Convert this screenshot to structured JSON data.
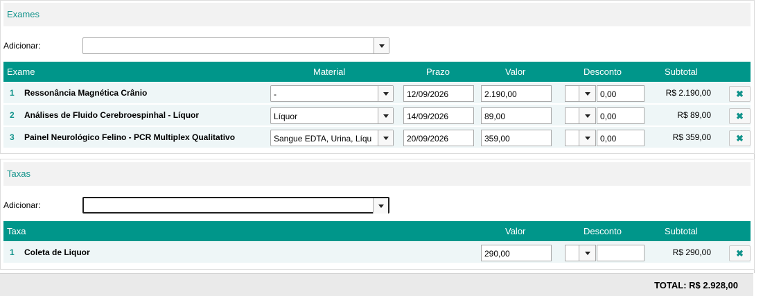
{
  "exames": {
    "title": "Exames",
    "add_label": "Adicionar:",
    "add_value": "",
    "columns": {
      "exame": "Exame",
      "material": "Material",
      "prazo": "Prazo",
      "valor": "Valor",
      "desconto": "Desconto",
      "subtotal": "Subtotal"
    },
    "rows": [
      {
        "num": "1",
        "name": "Ressonância Magnética Crânio",
        "material": "-",
        "prazo": "12/09/2026",
        "valor": "2.190,00",
        "desconto": "0,00",
        "subtotal": "R$ 2.190,00"
      },
      {
        "num": "2",
        "name": "Análises de Fluido Cerebroespinhal - Líquor",
        "material": "Líquor",
        "prazo": "14/09/2026",
        "valor": "89,00",
        "desconto": "0,00",
        "subtotal": "R$ 89,00"
      },
      {
        "num": "3",
        "name": "Painel Neurológico Felino - PCR Multiplex Qualitativo",
        "material": "Sangue EDTA, Urina, Líqu",
        "prazo": "20/09/2026",
        "valor": "359,00",
        "desconto": "0,00",
        "subtotal": "R$ 359,00"
      }
    ]
  },
  "taxas": {
    "title": "Taxas",
    "add_label": "Adicionar:",
    "add_value": "",
    "columns": {
      "taxa": "Taxa",
      "valor": "Valor",
      "desconto": "Desconto",
      "subtotal": "Subtotal"
    },
    "rows": [
      {
        "num": "1",
        "name": "Coleta de Liquor",
        "valor": "290,00",
        "desconto": "",
        "subtotal": "R$ 290,00"
      }
    ]
  },
  "delete_icon": "close-icon",
  "delete_glyph": "✖",
  "total": "TOTAL: R$ 2.928,00",
  "colors": {
    "header": "#00968a",
    "accent": "#12938b",
    "row_bg": "#eef6f7"
  }
}
